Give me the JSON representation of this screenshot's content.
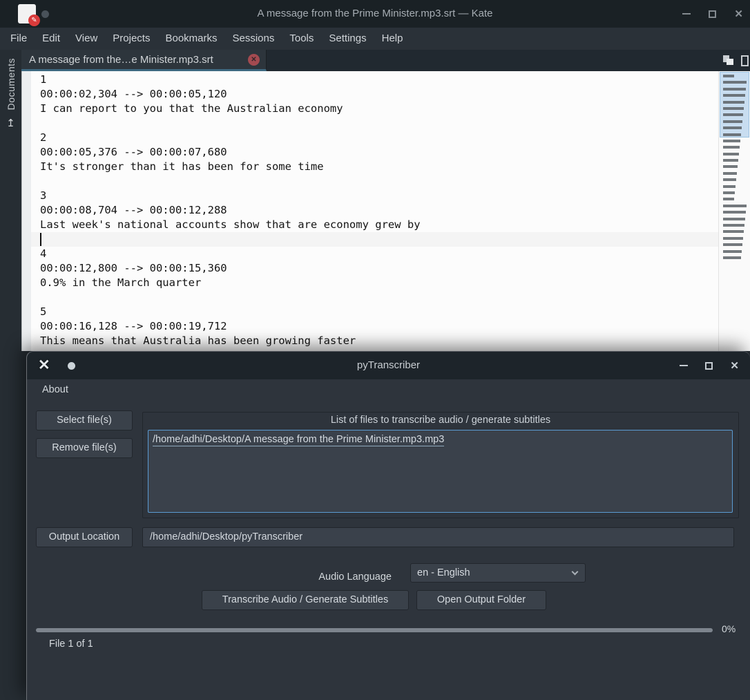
{
  "colors": {
    "accent_blue_border": "#5b9bd3",
    "tab_underline_blue": "#3d6880",
    "tab_close_red": "#a34a50",
    "kate_icon_badge_red": "#da3b3b",
    "editor_bg": "#fcfcfc",
    "window_bg_dark": "#2e343c"
  },
  "icons": {
    "pencil": "✎",
    "close": "✕",
    "tab_close": "✕",
    "up_arrow_from_bar": "↥",
    "pytranscriber_logo": "✕"
  },
  "kate": {
    "titlebar": {
      "title": "A message from the Prime Minister.mp3.srt — Kate"
    },
    "menu": {
      "items": [
        {
          "label": "File"
        },
        {
          "label": "Edit"
        },
        {
          "label": "View"
        },
        {
          "label": "Projects"
        },
        {
          "label": "Bookmarks"
        },
        {
          "label": "Sessions"
        },
        {
          "label": "Tools"
        },
        {
          "label": "Settings"
        },
        {
          "label": "Help"
        }
      ]
    },
    "tab": {
      "label": "A message from the…e Minister.mp3.srt"
    },
    "dock": {
      "label": "Documents"
    },
    "editor": {
      "cursor_line_index": 11,
      "lines": [
        "1",
        "00:00:02,304 --> 00:00:05,120",
        "I can report to you that the Australian economy",
        "",
        "2",
        "00:00:05,376 --> 00:00:07,680",
        "It's stronger than it has been for some time",
        "",
        "3",
        "00:00:08,704 --> 00:00:12,288",
        "Last week's national accounts show that are economy grew by",
        "",
        "4",
        "00:00:12,800 --> 00:00:15,360",
        "0.9% in the March quarter",
        "",
        "5",
        "00:00:16,128 --> 00:00:19,712",
        "This means that Australia has been growing faster"
      ]
    },
    "minimap": {
      "row_count": 29,
      "viewport_rows": 10
    }
  },
  "pytranscriber": {
    "titlebar": {
      "title": "pyTranscriber"
    },
    "menu": {
      "about_label": "About"
    },
    "buttons": {
      "select_files": "Select file(s)",
      "remove_files": "Remove file(s)",
      "output_location": "Output Location",
      "transcribe": "Transcribe Audio / Generate Subtitles",
      "open_output_folder": "Open Output Folder"
    },
    "file_group": {
      "title": "List of files to transcribe audio / generate subtitles",
      "files": [
        "/home/adhi/Desktop/A message from the Prime Minister.mp3.mp3"
      ]
    },
    "output_location_value": "/home/adhi/Desktop/pyTranscriber",
    "audio_language": {
      "label": "Audio Language",
      "selected": "en - English"
    },
    "progress": {
      "percent_label": "0%",
      "file_count_label": "File 1 of 1"
    }
  }
}
